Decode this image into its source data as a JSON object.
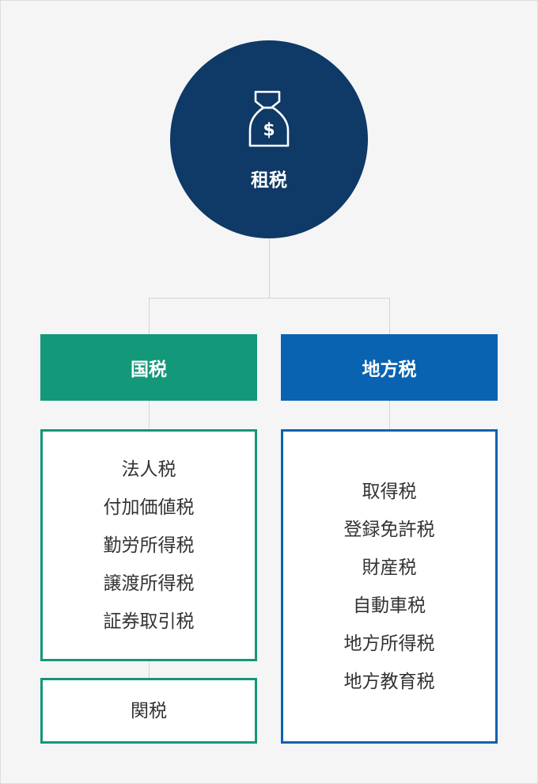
{
  "root": {
    "label": "租税",
    "icon": "money-bag-icon"
  },
  "categories": [
    {
      "label": "国税",
      "color": "#139879",
      "groups": [
        [
          "法人税",
          "付加価値税",
          "勤労所得税",
          "譲渡所得税",
          "証券取引税"
        ],
        [
          "関税"
        ]
      ]
    },
    {
      "label": "地方税",
      "color": "#0a63b1",
      "groups": [
        [
          "取得税",
          "登録免許税",
          "財産税",
          "自動車税",
          "地方所得税",
          "地方教育税"
        ]
      ]
    }
  ],
  "colors": {
    "root": "#0f3966",
    "line": "#d4d4d4",
    "background": "#f5f5f5"
  }
}
